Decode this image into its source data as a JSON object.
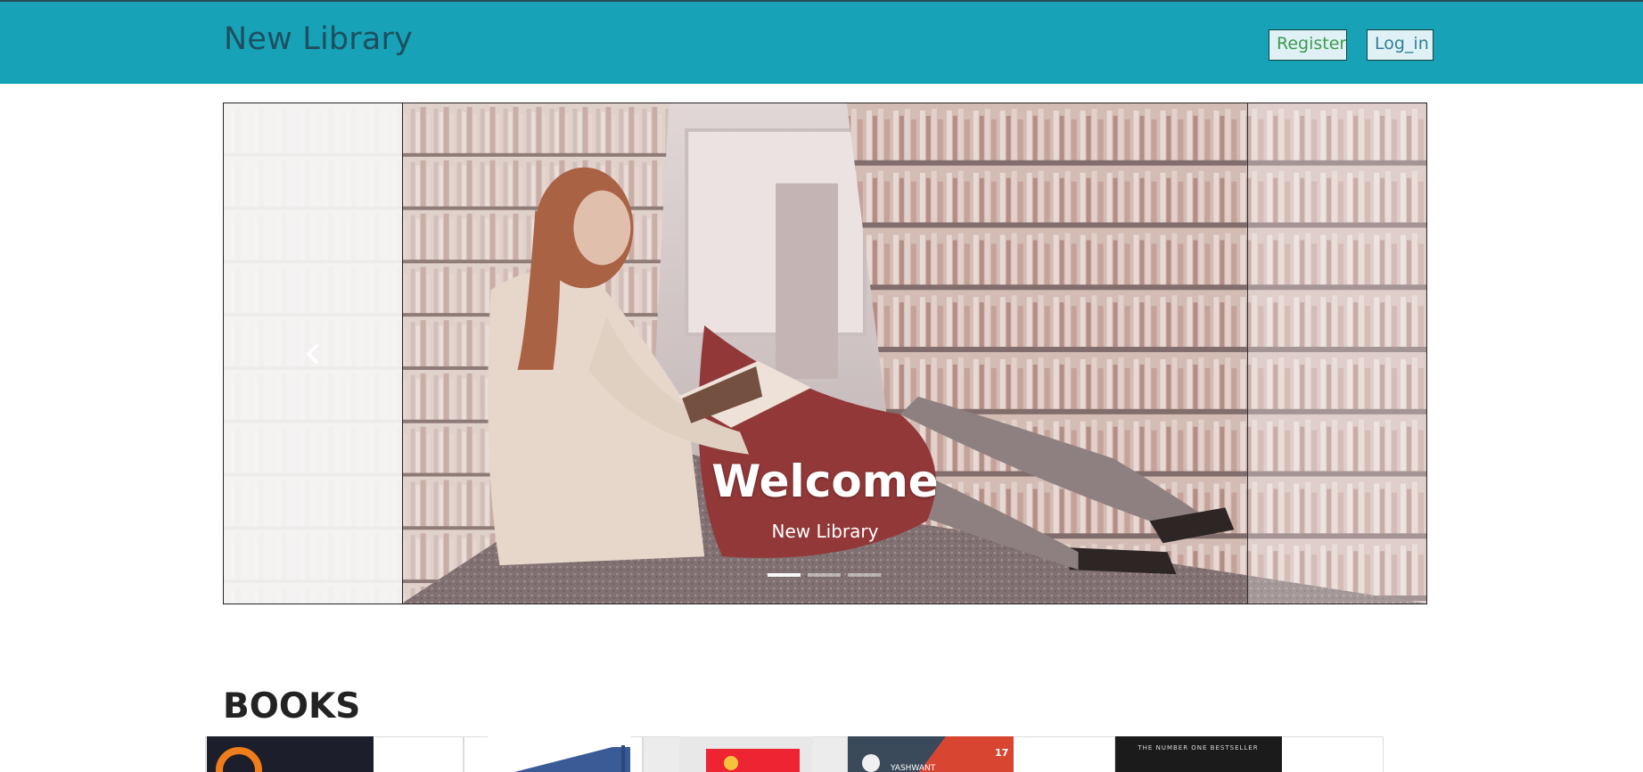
{
  "navbar": {
    "brand": "New Library",
    "register_label": "Register",
    "login_label": "Log_in",
    "colors": {
      "bar": "#17a2b8",
      "brand_text": "#1e4f5f"
    }
  },
  "carousel": {
    "slides": [
      {
        "title": "Welcome",
        "subtitle": "New Library",
        "image": "woman-reading-in-library-aisle"
      }
    ],
    "active_index": 0,
    "indicator_count": 3,
    "prev_icon": "chevron-left-icon"
  },
  "books": {
    "heading": "BOOKS",
    "covers": [
      {
        "name": "book-cover-orange-circle",
        "color": "#1c1f2b"
      },
      {
        "name": "book-cover-blue",
        "color": "#3a5b95"
      },
      {
        "name": "book-cover-red-badge",
        "color": "#e8e8e8"
      },
      {
        "name": "book-cover-yashwant",
        "color": "#d84632"
      },
      {
        "name": "book-cover-bestseller",
        "color": "#1b1b1b"
      }
    ],
    "cover_texts": [
      "YASHWANT",
      "THE NUMBER ONE BESTSELLER"
    ]
  }
}
